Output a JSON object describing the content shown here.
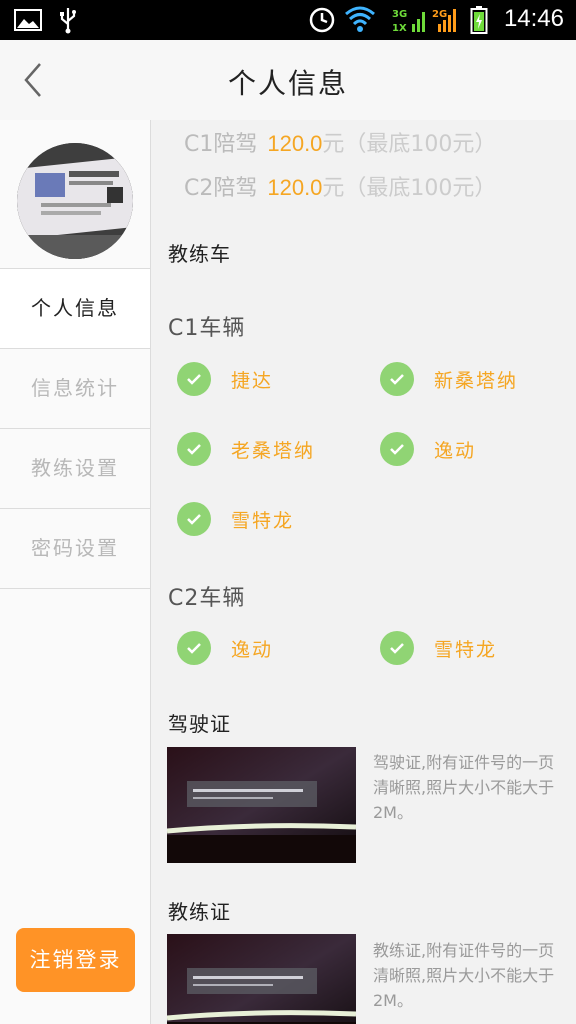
{
  "status_bar": {
    "time": "14:46",
    "icons": [
      "image-icon",
      "usb-icon",
      "alarm-icon",
      "wifi-icon",
      "signal-3g-icon",
      "signal-2g-icon",
      "battery-icon"
    ],
    "network_labels": [
      "3G",
      "1X",
      "2G"
    ]
  },
  "header": {
    "title": "个人信息",
    "back_icon": "chevron-left-icon"
  },
  "sidebar": {
    "items": [
      {
        "label": "个人信息",
        "active": true
      },
      {
        "label": "信息统计",
        "active": false
      },
      {
        "label": "教练设置",
        "active": false
      },
      {
        "label": "密码设置",
        "active": false
      }
    ],
    "logout_label": "注销登录"
  },
  "prices": [
    {
      "label": "C1陪驾",
      "price": "120.0",
      "unit": "元（最底100元）"
    },
    {
      "label": "C2陪驾",
      "price": "120.0",
      "unit": "元（最底100元）"
    }
  ],
  "coach_car": {
    "title": "教练车",
    "c1": {
      "title": "C1车辆",
      "cars": [
        "捷达",
        "新桑塔纳",
        "老桑塔纳",
        "逸动",
        "雪特龙"
      ]
    },
    "c2": {
      "title": "C2车辆",
      "cars": [
        "逸动",
        "雪特龙"
      ]
    }
  },
  "driver_license": {
    "title": "驾驶证",
    "desc": "驾驶证,附有证件号的一页清晰照,照片大小不能大于2M。"
  },
  "coach_license": {
    "title": "教练证",
    "desc": "教练证,附有证件号的一页清晰照,照片大小不能大于2M。"
  },
  "colors": {
    "accent": "#ff9326",
    "price": "#f5a623",
    "check": "#90d474"
  }
}
